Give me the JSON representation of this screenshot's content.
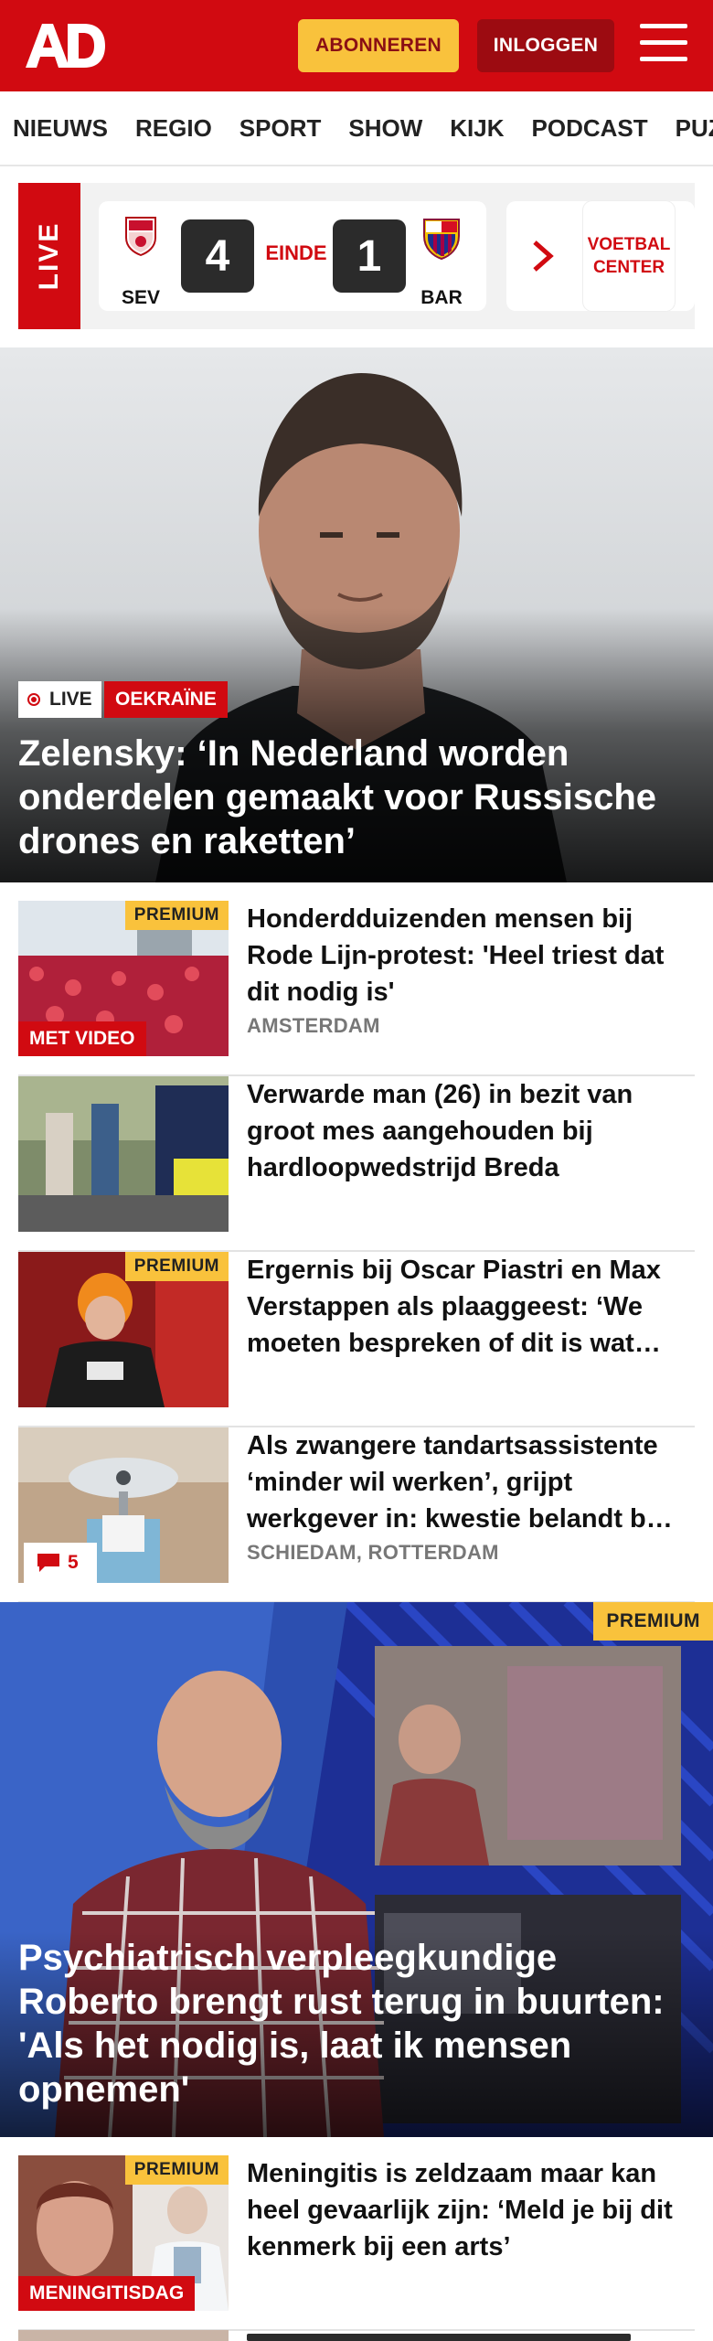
{
  "header": {
    "logo_text": "AD",
    "subscribe_label": "ABONNEREN",
    "login_label": "INLOGGEN"
  },
  "nav": {
    "items": [
      "NIEUWS",
      "REGIO",
      "SPORT",
      "SHOW",
      "KIJK",
      "PODCAST",
      "PUZZ"
    ]
  },
  "live": {
    "tab_label": "LIVE",
    "match": {
      "home_team": "SEV",
      "home_score": "4",
      "status": "EINDE",
      "away_score": "1",
      "away_team": "BAR"
    },
    "voetbalcenter_label_1": "VOETBAL",
    "voetbalcenter_label_2": "CENTER"
  },
  "hero": {
    "live_label": "LIVE",
    "category": "OEKRAÏNE",
    "title": "Zelensky: ‘In Nederland worden onderdelen gemaakt voor Russische drones en raketten’"
  },
  "articles": [
    {
      "title": "Honderdduizenden mensen bij Rode Lijn-protest: 'Heel triest dat dit nodig is'",
      "location": "AMSTERDAM",
      "premium": "PREMIUM",
      "label": "MET VIDEO"
    },
    {
      "title": "Verwarde man (26) in bezit van groot mes aangehouden bij hardloopwedstrijd Breda"
    },
    {
      "title": "Ergernis bij Oscar Piastri en Max Verstappen als plaaggeest: ‘We moeten bespreken of dit is wat…",
      "premium": "PREMIUM"
    },
    {
      "title": "Als zwangere tandartsassistente ‘minder wil werken’, grijpt werkgever in: kwestie belandt b…",
      "location": "SCHIEDAM, ROTTERDAM",
      "comments": "5"
    }
  ],
  "feature": {
    "premium": "PREMIUM",
    "title": "Psychiatrisch verpleegkundige Roberto brengt rust terug in buurten: 'Als het nodig is, laat ik mensen opnemen'"
  },
  "article_after": {
    "title": "Meningitis is zeldzaam maar kan heel gevaarlijk zijn: ‘Meld je bij dit kenmerk bij een arts’",
    "premium": "PREMIUM",
    "label": "MENINGITISDAG"
  },
  "colors": {
    "brand_red": "#d10a11",
    "premium_yellow": "#f9c23c"
  }
}
